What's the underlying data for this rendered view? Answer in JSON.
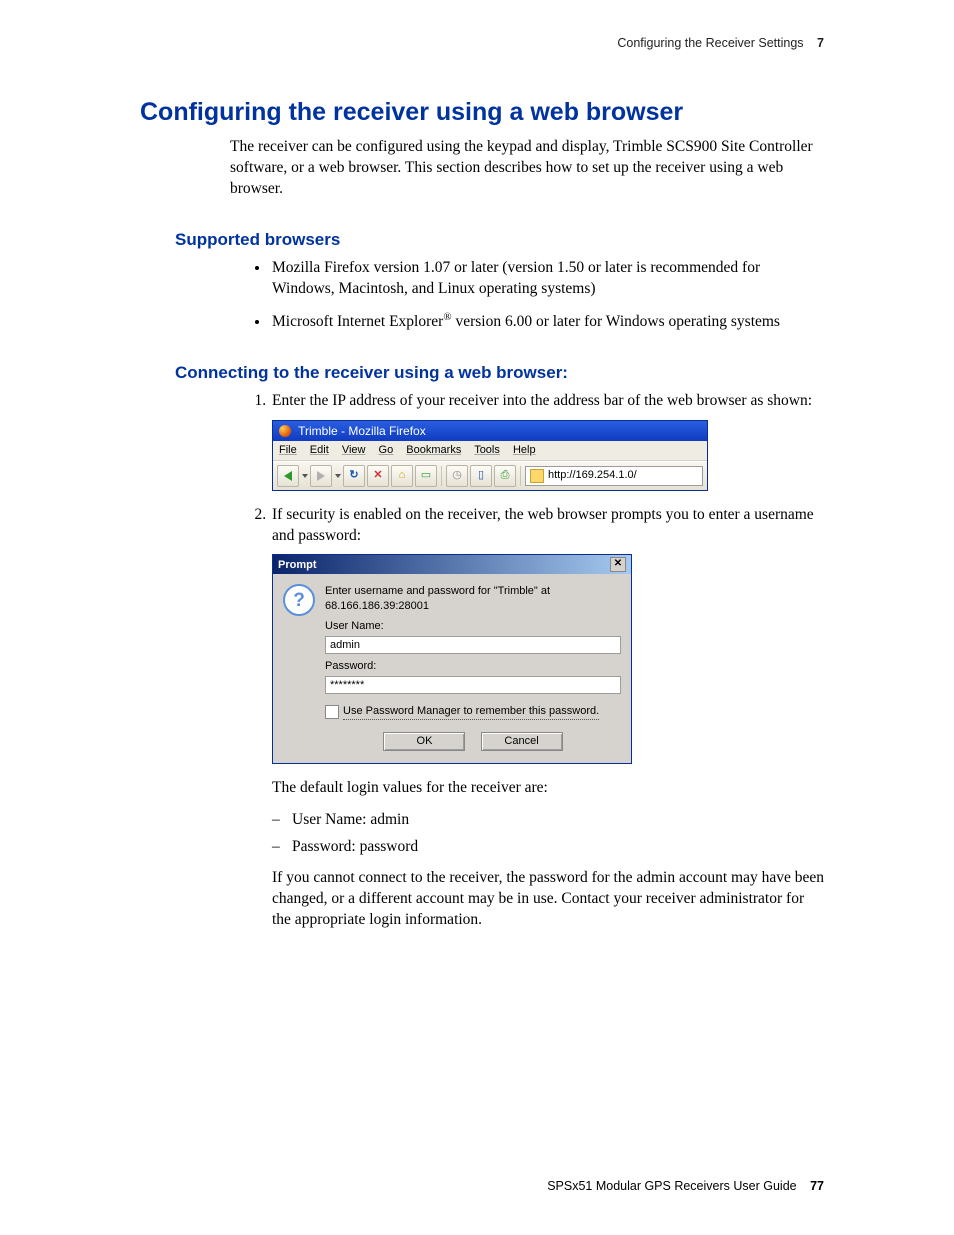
{
  "header": {
    "section": "Configuring the Receiver Settings",
    "chapter": "7"
  },
  "h1": "Configuring the receiver using a web browser",
  "intro": "The receiver can be configured using the keypad and display, Trimble SCS900 Site Controller software, or a web browser. This section describes how to set up the receiver using a web browser.",
  "sub1": "Supported browsers",
  "browsers": {
    "b1": "Mozilla Firefox version 1.07 or later (version 1.50 or later is recommended for Windows, Macintosh, and Linux operating systems)",
    "b2a": "Microsoft Internet Explorer",
    "b2b": " version 6.00 or later for Windows operating systems"
  },
  "sub2": "Connecting to the receiver using a web browser:",
  "step1": "Enter the IP address of your receiver into the address bar of the web browser as shown:",
  "ff": {
    "title": "Trimble - Mozilla Firefox",
    "menu": {
      "file": "File",
      "edit": "Edit",
      "view": "View",
      "go": "Go",
      "bookmarks": "Bookmarks",
      "tools": "Tools",
      "help": "Help"
    },
    "url": "http://169.254.1.0/"
  },
  "step2": "If security is enabled on the receiver, the web browser prompts you to enter a username and password:",
  "dlg": {
    "title": "Prompt",
    "msg": "Enter username and password for \"Trimble\" at 68.166.186.39:28001",
    "user_label": "User Name:",
    "user_value": "admin",
    "pass_label": "Password:",
    "pass_value": "********",
    "remember": "Use Password Manager to remember this password.",
    "ok": "OK",
    "cancel": "Cancel"
  },
  "defaults_intro": "The default login values for the receiver are:",
  "defaults": {
    "u": "User Name: admin",
    "p": "Password: password"
  },
  "cannot": "If you cannot connect to the receiver, the password for the admin account may have been changed, or a different account may be in use. Contact your receiver administrator for the appropriate login information.",
  "footer": {
    "book": "SPSx51 Modular GPS Receivers User Guide",
    "page": "77"
  }
}
